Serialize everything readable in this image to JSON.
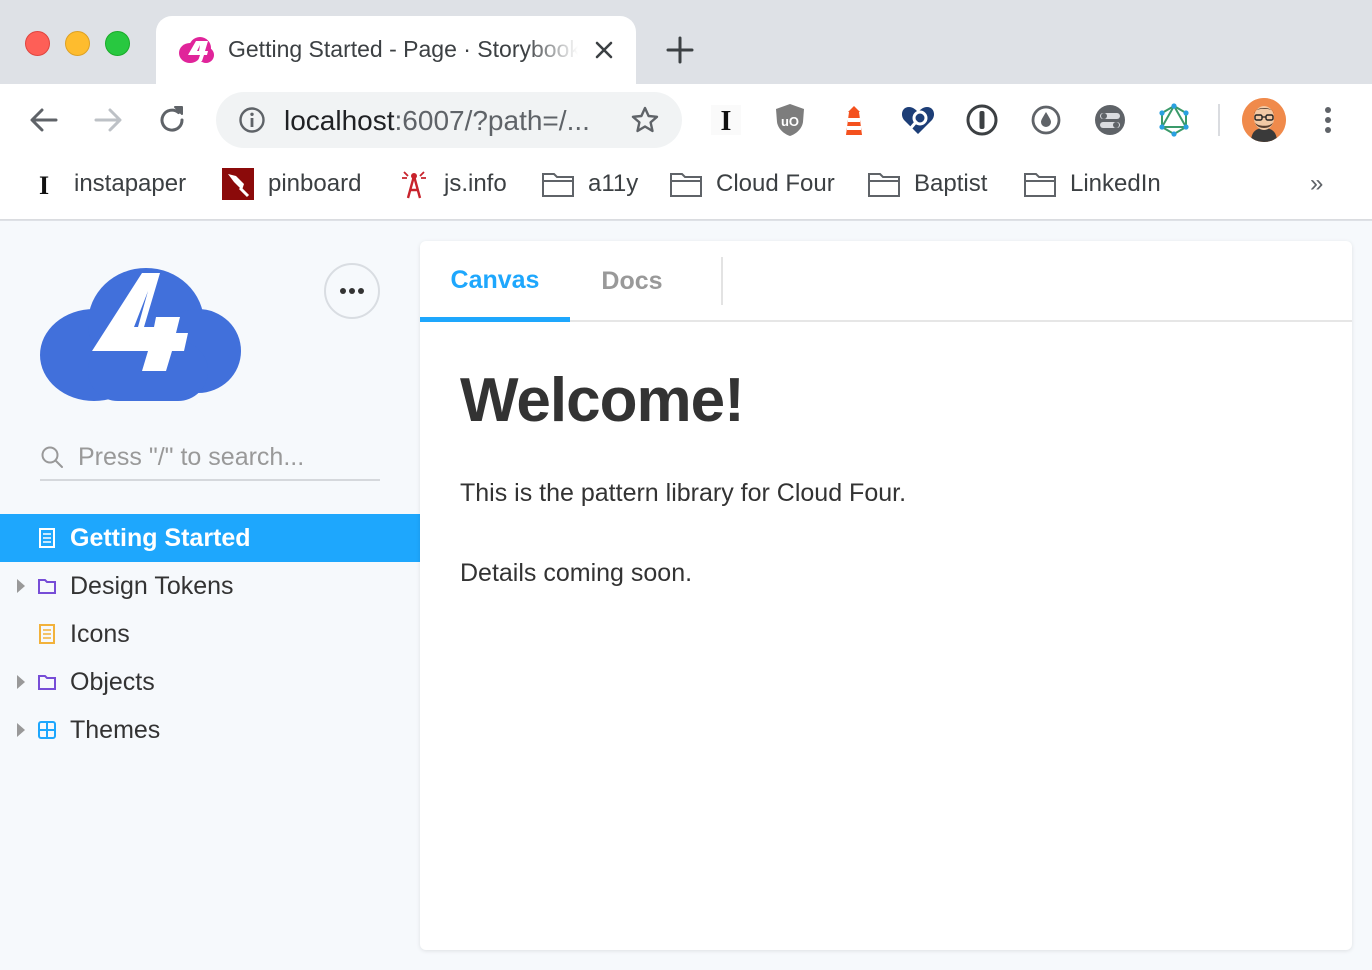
{
  "browser": {
    "tab": {
      "title": "Getting Started - Page · Storybook"
    },
    "address_bar": {
      "url_host": "localhost",
      "url_path": ":6007/?path=/..."
    },
    "bookmarks": [
      {
        "label": "instapaper",
        "icon": "instapaper-icon"
      },
      {
        "label": "pinboard",
        "icon": "pinboard-icon"
      },
      {
        "label": "js.info",
        "icon": "javascript-info-icon"
      },
      {
        "label": "a11y",
        "icon": "folder-icon"
      },
      {
        "label": "Cloud Four",
        "icon": "folder-icon"
      },
      {
        "label": "Baptist",
        "icon": "folder-icon"
      },
      {
        "label": "LinkedIn",
        "icon": "folder-icon"
      }
    ],
    "bookmarks_overflow": "»",
    "extensions": [
      "instapaper-extension-icon",
      "ublock-origin-icon",
      "lighthouse-icon",
      "axe-devtools-icon",
      "1password-icon",
      "dropper-extension-icon",
      "toggle-extension-icon",
      "graphql-icon"
    ]
  },
  "sidebar": {
    "search": {
      "placeholder": "Press \"/\" to search..."
    },
    "items": [
      {
        "label": "Getting Started",
        "type": "document",
        "selected": true,
        "expandable": false
      },
      {
        "label": "Design Tokens",
        "type": "folder",
        "selected": false,
        "expandable": true
      },
      {
        "label": "Icons",
        "type": "document",
        "selected": false,
        "expandable": false
      },
      {
        "label": "Objects",
        "type": "folder",
        "selected": false,
        "expandable": true
      },
      {
        "label": "Themes",
        "type": "component",
        "selected": false,
        "expandable": true
      }
    ]
  },
  "panel": {
    "tabs": [
      {
        "label": "Canvas",
        "active": true
      },
      {
        "label": "Docs",
        "active": false
      }
    ],
    "heading": "Welcome!",
    "paragraphs": [
      "This is the pattern library for Cloud Four.",
      "Details coming soon."
    ]
  },
  "colors": {
    "accent": "#1ea7fd",
    "logo_blue": "#4170db",
    "folder_purple": "#774dd7",
    "document_orange": "#f2b23b"
  }
}
